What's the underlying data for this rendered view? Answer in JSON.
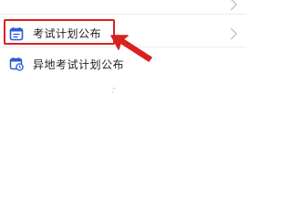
{
  "menu": {
    "exam_plan": {
      "label": "考试计划公布",
      "icon": "calendar-list-icon",
      "chevron": "chevron-right-icon"
    },
    "remote_exam_plan": {
      "label": "异地考试计划公布",
      "icon": "calendar-clock-icon"
    }
  },
  "colors": {
    "accent": "#2f5bd3",
    "highlight": "#d9211f",
    "divider": "#eeeeee",
    "chevron": "#bbbbbb"
  }
}
